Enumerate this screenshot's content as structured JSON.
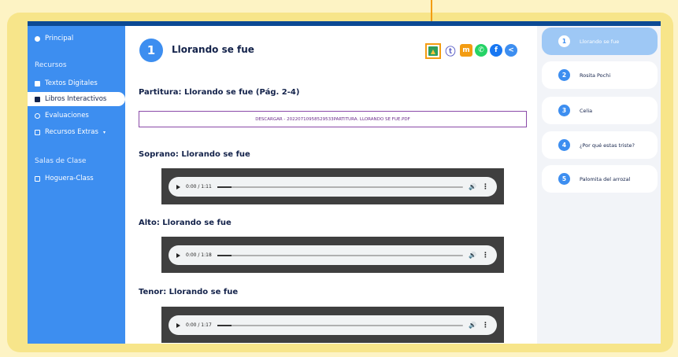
{
  "sidebar": {
    "home_label": "Principal",
    "section_resources": "Recursos",
    "items": [
      {
        "label": "Textos Digitales",
        "icon": "book-icon"
      },
      {
        "label": "Libros Interactivos",
        "icon": "book-icon"
      },
      {
        "label": "Evaluaciones",
        "icon": "clipboard-icon"
      },
      {
        "label": "Recursos Extras",
        "icon": "folder-icon"
      }
    ],
    "section_classrooms": "Salas de Clase",
    "classroom_label": "Hoguera-Class"
  },
  "lesson": {
    "number": "1",
    "title": "Llorando se fue"
  },
  "share_icons": [
    "google-classroom-icon",
    "teams-icon",
    "moodle-icon",
    "whatsapp-icon",
    "facebook-icon",
    "share-icon"
  ],
  "score": {
    "title": "Partitura: Llorando se fue (Pág. 2-4)",
    "download_label": "DESCARGAR - 20220710958529533PARTITURA. LLORANDO SE FUE.PDF"
  },
  "audios": [
    {
      "title": "Soprano: Llorando se fue",
      "time": "0:00 / 1:11"
    },
    {
      "title": "Alto: Llorando se fue",
      "time": "0:00 / 1:18"
    },
    {
      "title": "Tenor: Llorando se fue",
      "time": "0:00 / 1:17"
    }
  ],
  "playlist": [
    {
      "num": "1",
      "label": "Llorando se fue"
    },
    {
      "num": "2",
      "label": "Rosita Pochi"
    },
    {
      "num": "3",
      "label": "Celia"
    },
    {
      "num": "4",
      "label": "¿Por qué estas triste?"
    },
    {
      "num": "5",
      "label": "Palomita del arrozal"
    }
  ],
  "colors": {
    "accent": "#3d8ef0",
    "highlight": "#f39c12",
    "navy": "#13224a"
  }
}
